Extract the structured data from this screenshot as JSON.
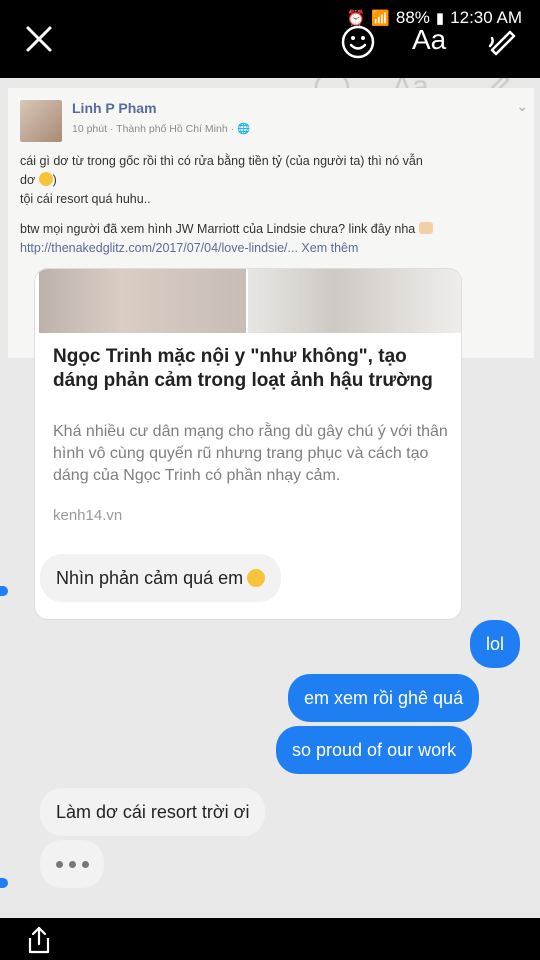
{
  "status_bar": {
    "battery": "88%",
    "time": "12:30 AM"
  },
  "editor_tools": {
    "text_tool_label": "Aa"
  },
  "post": {
    "author": "Linh P Pham",
    "meta": "10 phút · Thành phố Hồ Chí Minh · 🌐",
    "line1": "cái gì dơ từ trong gốc rồi thì có rửa bằng tiền tỷ (của người ta) thì nó vẫn",
    "line2": "dơ",
    "line3": "tội cái resort quá huhu..",
    "btw": "btw mọi người đã xem hình JW Marriott của Lindsie chưa? link đây nha",
    "link": "http://thenakedglitz.com/2017/07/04/love-lindsie/...",
    "see_more": " Xem thêm"
  },
  "card": {
    "title": "Ngọc Trinh mặc nội y \"như không\", tạo dáng phản cảm trong loạt ảnh hậu trường",
    "description": "Khá nhiều cư dân mạng cho rằng dù gây chú ý với thân hình vô cùng quyến rũ nhưng trang phục và cách tạo dáng của Ngọc Trinh có phần nhạy cảm.",
    "domain": "kenh14.vn"
  },
  "messages": [
    {
      "from": "them",
      "text": "Nhìn phản cảm quá em"
    },
    {
      "from": "me",
      "text": "lol"
    },
    {
      "from": "me",
      "text": "em xem rồi ghê quá"
    },
    {
      "from": "me",
      "text": "so proud of our work"
    },
    {
      "from": "them",
      "text": "Làm dơ cái resort trời ơi"
    }
  ],
  "colors": {
    "bubble_out": "#1f7ff2",
    "bubble_in": "#f2f2f2",
    "link": "#5a6c9a"
  }
}
